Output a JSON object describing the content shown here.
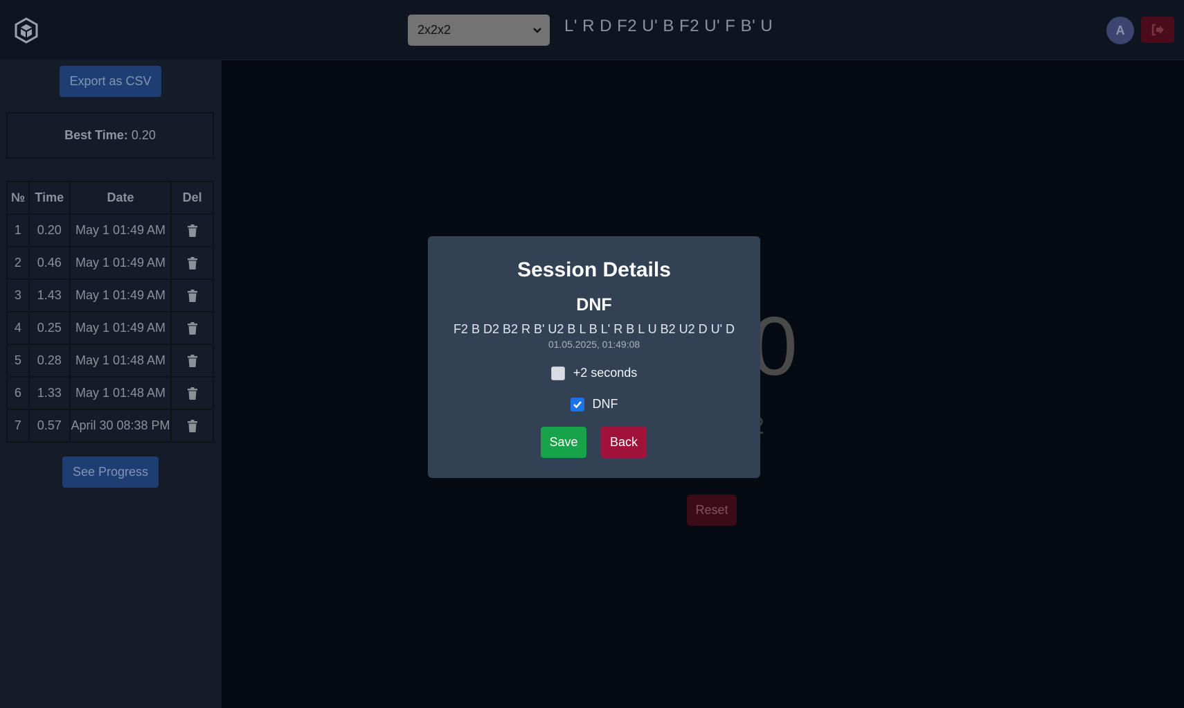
{
  "header": {
    "puzzle_select": {
      "selected": "2x2x2"
    },
    "scramble": "L' R D F2 U' B F2 U' F B' U",
    "avatar_letter": "A",
    "icons": [
      "cube-logo-icon",
      "chevron-down-icon",
      "logout-icon"
    ]
  },
  "sidebar": {
    "export_label": "Export as CSV",
    "best_time_label": "Best Time:",
    "best_time_value": "0.20",
    "table": {
      "headers": [
        "№",
        "Time",
        "Date",
        "Del"
      ],
      "rows": [
        {
          "no": "1",
          "time": "0.20",
          "date": "May 1 01:49 AM"
        },
        {
          "no": "2",
          "time": "0.46",
          "date": "May 1 01:49 AM"
        },
        {
          "no": "3",
          "time": "1.43",
          "date": "May 1 01:49 AM"
        },
        {
          "no": "4",
          "time": "0.25",
          "date": "May 1 01:49 AM"
        },
        {
          "no": "5",
          "time": "0.28",
          "date": "May 1 01:48 AM"
        },
        {
          "no": "6",
          "time": "1.33",
          "date": "May 1 01:48 AM"
        },
        {
          "no": "7",
          "time": "0.57",
          "date": "April 30 08:38 PM"
        }
      ]
    },
    "progress_label": "See Progress"
  },
  "main": {
    "timer_fragment": "0",
    "small_fragment": "2",
    "reset_label": "Reset"
  },
  "modal": {
    "title": "Session Details",
    "result": "DNF",
    "scramble": "F2 B D2 B2 R B' U2 B L B L' R B L U B2 U2 D U' D",
    "date": "01.05.2025, 01:49:08",
    "plus2_label": "+2 seconds",
    "plus2_checked": false,
    "dnf_label": "DNF",
    "dnf_checked": true,
    "save_label": "Save",
    "back_label": "Back"
  },
  "colors": {
    "save": "#16a34a",
    "back": "#9f1239",
    "modal_bg": "#334155",
    "checkbox_on": "#1a73e8"
  }
}
